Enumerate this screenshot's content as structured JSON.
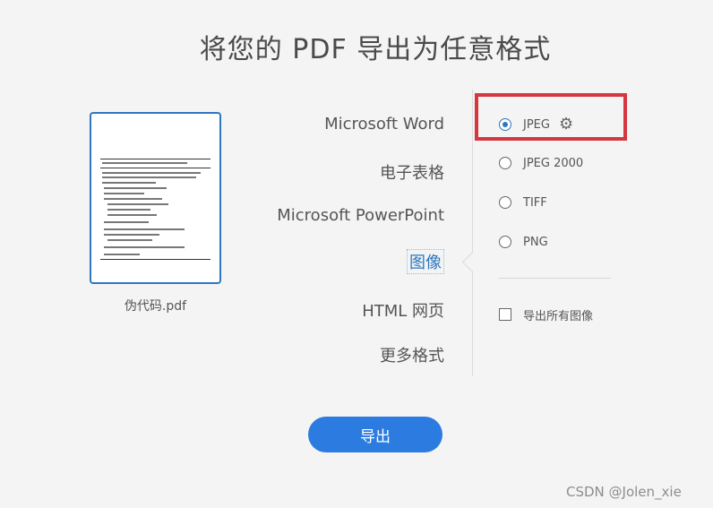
{
  "title": "将您的 PDF 导出为任意格式",
  "file": {
    "name": "伪代码.pdf"
  },
  "formats": [
    {
      "label": "Microsoft Word"
    },
    {
      "label": "电子表格"
    },
    {
      "label": "Microsoft PowerPoint"
    },
    {
      "label": "图像",
      "selected": true
    },
    {
      "label": "HTML 网页"
    },
    {
      "label": "更多格式"
    }
  ],
  "image_options": [
    {
      "label": "JPEG",
      "checked": true,
      "has_settings": true
    },
    {
      "label": "JPEG 2000",
      "checked": false
    },
    {
      "label": "TIFF",
      "checked": false
    },
    {
      "label": "PNG",
      "checked": false
    }
  ],
  "export_all_images": {
    "label": "导出所有图像",
    "checked": false
  },
  "export_button": {
    "label": "导出"
  },
  "watermark": "CSDN @Jolen_xie",
  "colors": {
    "accent": "#2b7be0",
    "highlight": "#d5373f",
    "selected_text": "#2d77c0"
  }
}
